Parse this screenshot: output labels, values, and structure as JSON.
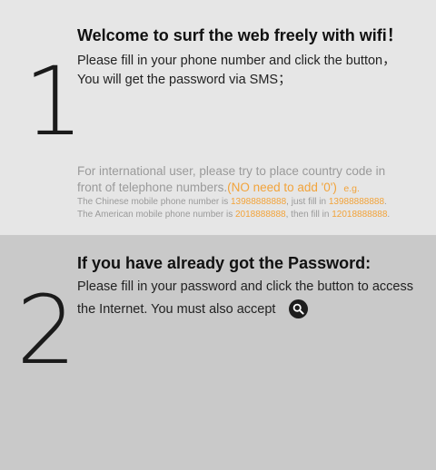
{
  "step1": {
    "number": "1",
    "title": "Welcome to surf the web freely with wifi！",
    "line1": "Please fill in your phone number and click the button，",
    "line2": "You will get the password via SMS；",
    "intl_line1": "For international user, please try to place country code in",
    "intl_line2_prefix": "front of telephone numbers.",
    "intl_line2_highlight": "(NO need to add '0')",
    "intl_line2_eg": "e.g.",
    "chinese_prefix": "The Chinese mobile phone number is ",
    "chinese_number": "13988888888",
    "chinese_mid": ", just fill in ",
    "chinese_fill": "13988888888",
    "chinese_end": ".",
    "american_prefix": "The American mobile phone number is ",
    "american_number": "2018888888",
    "american_mid": ", then fill in ",
    "american_fill": "12018888888",
    "american_end": "."
  },
  "step2": {
    "number": "2",
    "title": "If you have already got the Password:",
    "line1": "Please fill in your password and click the button to access",
    "line2": "the Internet. You must also accept"
  },
  "icons": {
    "search_button": "search-icon"
  },
  "colors": {
    "panel1_bg": "#e6e6e6",
    "panel2_bg": "#c9c9c9",
    "highlight": "#f2a33a",
    "muted": "#9a9a9a"
  }
}
